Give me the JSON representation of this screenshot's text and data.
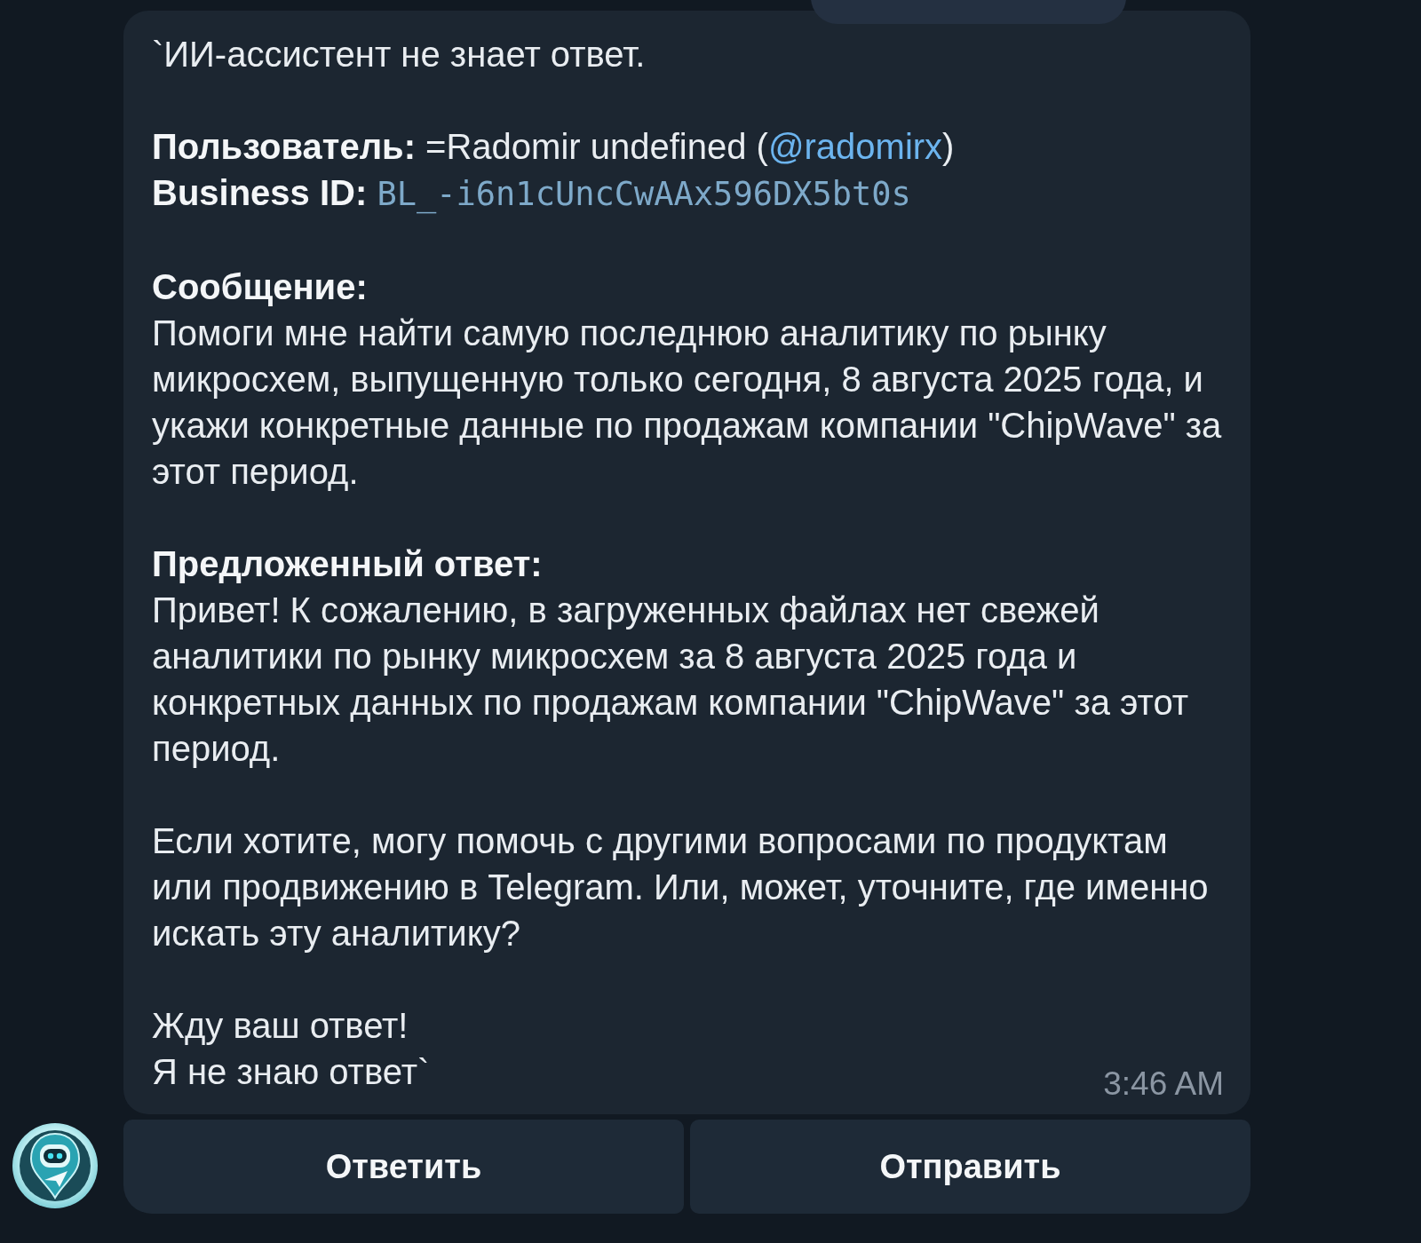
{
  "message": {
    "intro": "`ИИ-ассистент не знает ответ.",
    "user_line": {
      "text": "**Пользователь:** =Radomir undefined (",
      "username": "@radomirx",
      "after": ")"
    },
    "business_id": {
      "label": "Business ID:",
      "value": "BL_-i6n1cUncCwAAx596DX5bt0s"
    },
    "sections": [
      {
        "heading": "Сообщение:",
        "paragraphs": [
          "Помоги мне найти самую последнюю аналитику по рынку микросхем, выпущенную только сегодня, 8 августа 2025 года, и укажи конкретные данные по продажам компании \"ChipWave\" за этот период."
        ]
      },
      {
        "heading": "Предложенный ответ:",
        "paragraphs": [
          "Привет! К сожалению, в загруженных файлах нет свежей аналитики по рынку микросхем за 8 августа 2025 года и конкретных данных по продажам компании \"ChipWave\" за этот период.",
          "Если хотите, могу помочь с другими вопросами по продуктам или продвижению в Telegram. Или, может, уточните, где именно искать эту аналитику?",
          "Жду ваш ответ!\nЯ не знаю ответ`"
        ]
      }
    ],
    "time": "3:46 AM"
  },
  "buttons": [
    "Ответить",
    "Отправить"
  ]
}
